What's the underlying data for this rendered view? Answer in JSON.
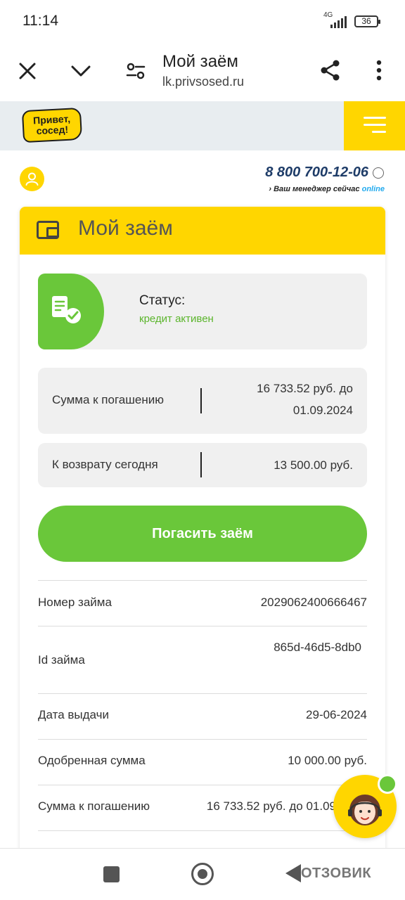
{
  "statusbar": {
    "time": "11:14",
    "network": "4G",
    "battery": "36"
  },
  "browser": {
    "title": "Мой заём",
    "url": "lk.privsosed.ru",
    "icons": [
      "close-icon",
      "chevron-down-icon",
      "tune-icon",
      "share-icon",
      "more-vert-icon"
    ]
  },
  "site": {
    "logo_line1": "Привет,",
    "logo_line2": "сосед!",
    "phone": "8 800 700-12-06",
    "manager_text": "Ваш менеджер сейчас",
    "manager_status": "online"
  },
  "loan": {
    "header": "Мой заём",
    "status_label": "Статус:",
    "status_value": "кредит активен",
    "repay_label": "Сумма к погашению",
    "repay_value_line1": "16 733.52 руб. до",
    "repay_value_line2": "01.09.2024",
    "today_label": "К возврату сегодня",
    "today_value": "13 500.00 руб.",
    "pay_button": "Погасить заём"
  },
  "details": [
    {
      "key": "Номер займа",
      "value": "2029062400666467"
    },
    {
      "key": "Id займа",
      "value": "865d-46d5-8db0"
    },
    {
      "key": "Дата выдачи",
      "value": "29-06-2024"
    },
    {
      "key": "Одобренная сумма",
      "value": "10 000.00 руб."
    },
    {
      "key": "Сумма к погашению",
      "value": "16 733.52 руб. до 01.09"
    }
  ],
  "watermark": "ОТЗОВИК",
  "colors": {
    "brand_yellow": "#ffd600",
    "brand_green": "#6ac73a",
    "phone_blue": "#1e3c68",
    "online_blue": "#22aaee"
  }
}
